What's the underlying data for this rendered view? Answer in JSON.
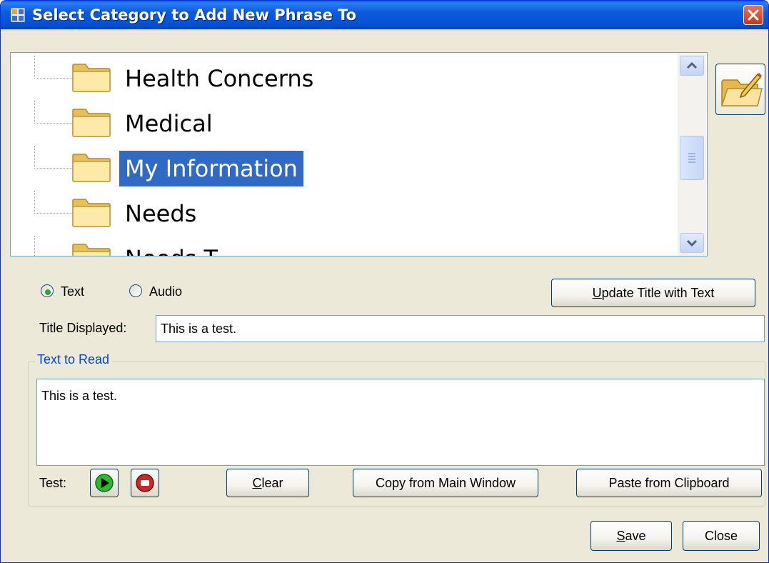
{
  "window": {
    "title": "Select Category to Add New Phrase To",
    "accent_color": "#0a5fd8",
    "icons": {
      "app": "app-window-icon",
      "close": "close-icon"
    }
  },
  "tree": {
    "items": [
      {
        "label": "Health Concerns",
        "selected": false,
        "icon": "folder-icon"
      },
      {
        "label": "Medical",
        "selected": false,
        "icon": "folder-icon"
      },
      {
        "label": "My Information",
        "selected": true,
        "icon": "folder-icon"
      },
      {
        "label": "Needs",
        "selected": false,
        "icon": "folder-icon"
      },
      {
        "label": "Needs T",
        "selected": false,
        "icon": "folder-icon"
      }
    ],
    "selection_color": "#316ac5"
  },
  "side": {
    "edit_icon": "folder-edit-icon"
  },
  "options": {
    "text_label": "Text",
    "audio_label": "Audio",
    "selected": "Text",
    "update_title_button_u": "U",
    "update_title_button_rest": "pdate Title with Text"
  },
  "title_field": {
    "label": "Title Displayed:",
    "value": "This is a test."
  },
  "text_group": {
    "label": "Text to Read",
    "value": "This is a test.",
    "label_color": "#0046d5"
  },
  "test_row": {
    "label": "Test:",
    "play_icon": "play-icon",
    "stop_icon": "stop-icon",
    "clear_u": "C",
    "clear_rest": "lear",
    "copy_label": "Copy from Main Window",
    "paste_label": "Paste from Clipboard"
  },
  "footer": {
    "save_u": "S",
    "save_rest": "ave",
    "close_label": "Close"
  }
}
